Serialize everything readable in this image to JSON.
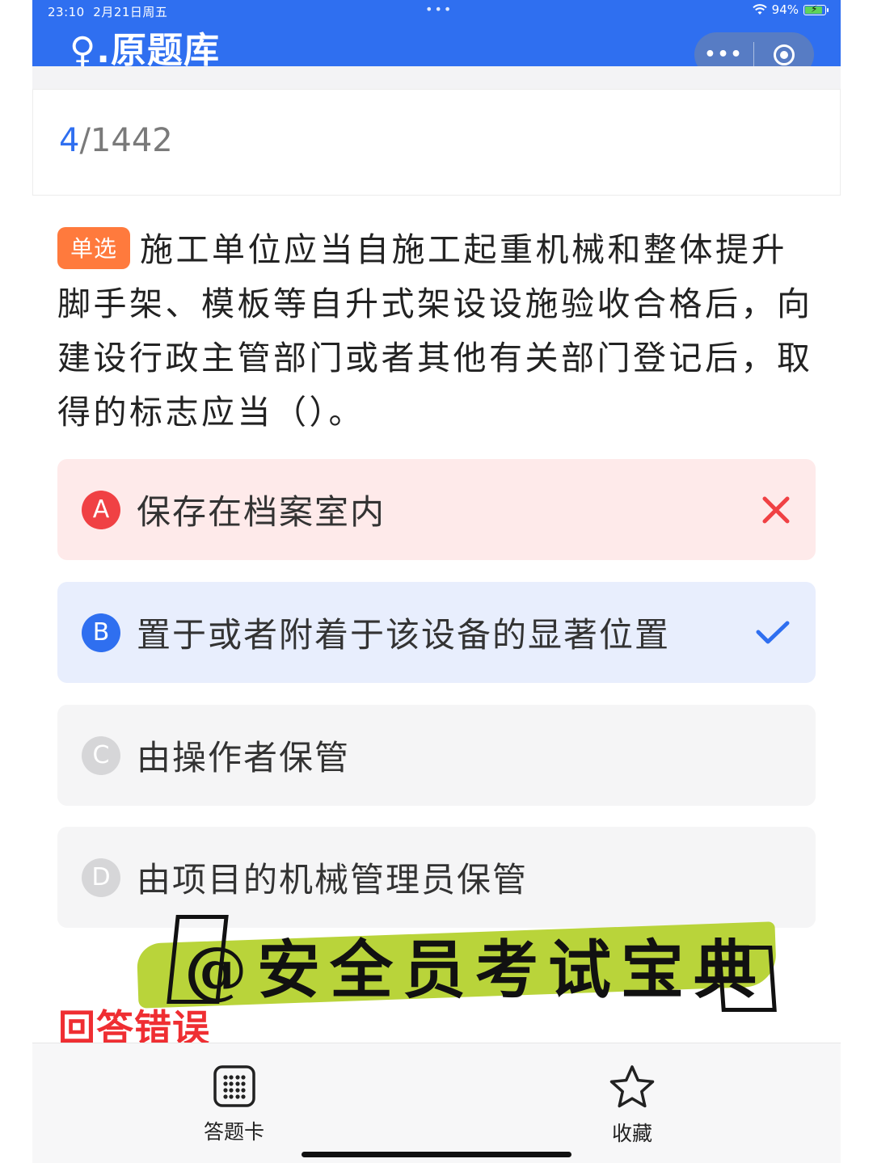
{
  "status_bar": {
    "time": "23:10",
    "date": "2月21日周五",
    "battery": "94%",
    "battery_level": 0.94
  },
  "header": {
    "title": "♀.原题库",
    "more_label": "•••"
  },
  "progress": {
    "current": "4",
    "total": "/1442"
  },
  "question": {
    "type_tag": "单选",
    "text": "施工单位应当自施工起重机械和整体提升脚手架、模板等自升式架设设施验收合格后，向建设行政主管部门或者其他有关部门登记后，取得的标志应当（）。"
  },
  "options": [
    {
      "letter": "A",
      "text": "保存在档案室内",
      "state": "wrong"
    },
    {
      "letter": "B",
      "text": "置于或者附着于该设备的显著位置",
      "state": "correct"
    },
    {
      "letter": "C",
      "text": "由操作者保管",
      "state": "none"
    },
    {
      "letter": "D",
      "text": "由项目的机械管理员保管",
      "state": "none"
    }
  ],
  "watermark": {
    "text": "@安全员考试宝典"
  },
  "result": {
    "text": "回答错误"
  },
  "bottom_bar": {
    "answer_card_label": "答题卡",
    "favorite_label": "收藏"
  },
  "colors": {
    "brand": "#2f6ff0",
    "wrong": "#f04144",
    "tag": "#ff7a3d",
    "watermark_brush": "#b9d43a"
  }
}
